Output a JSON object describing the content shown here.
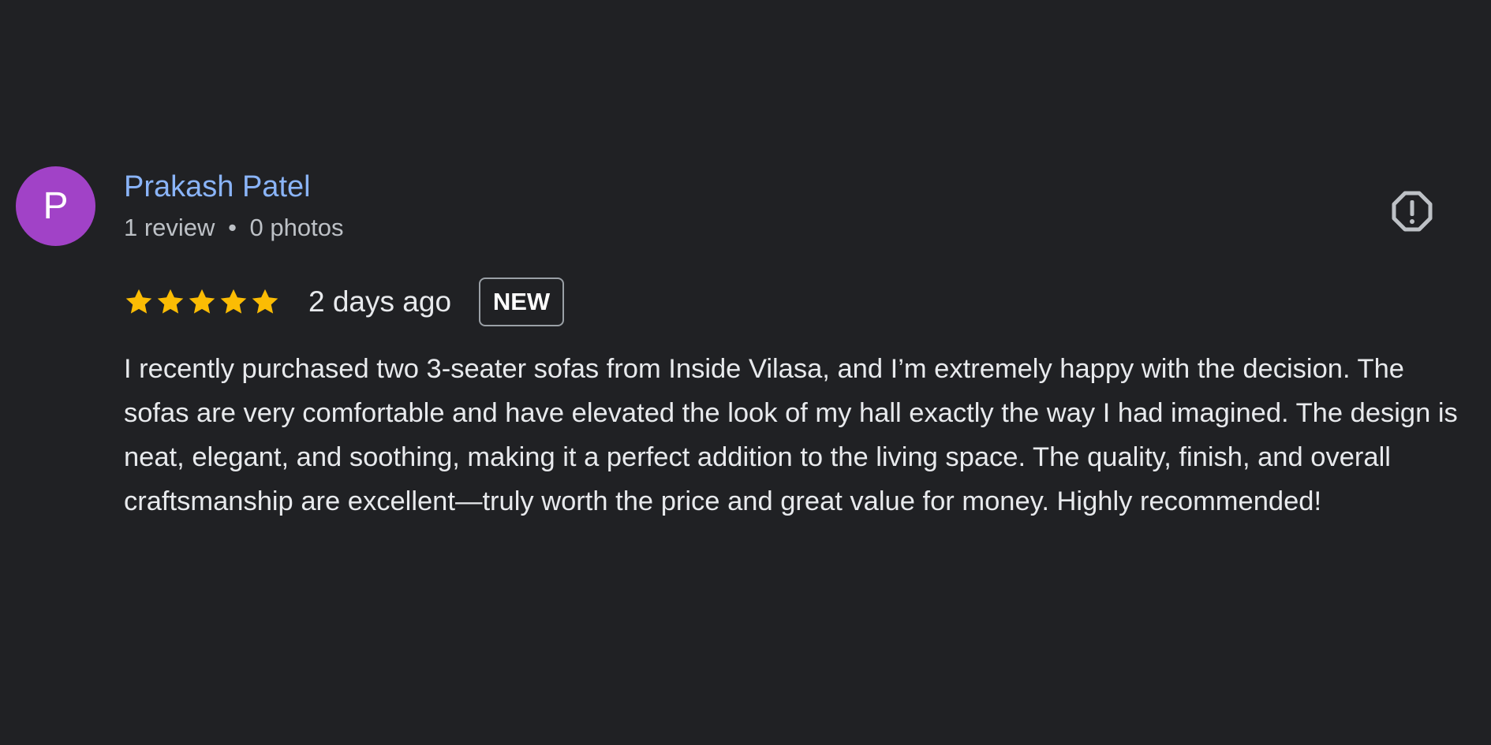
{
  "review": {
    "author": {
      "initial": "P",
      "avatar_color": "#a142c7",
      "name": "Prakash Patel",
      "name_color": "#8ab4f8",
      "review_count": "1 review",
      "separator": "•",
      "photo_count": "0 photos"
    },
    "rating": {
      "value": 5,
      "max": 5,
      "star_color": "#fbbc04"
    },
    "date": "2 days ago",
    "badge": "NEW",
    "text": "I recently purchased two 3-seater sofas from Inside Vilasa, and I’m extremely happy with the decision. The sofas are very comfortable and have elevated the look of my hall exactly the way I had imagined. The design is neat, elegant, and soothing, making it a perfect addition to the living space. The quality, finish, and overall craftsmanship are excellent—truly worth the price and great value for money. Highly recommended!",
    "report_icon": "report-alert-icon",
    "star_icon": "star-icon"
  }
}
